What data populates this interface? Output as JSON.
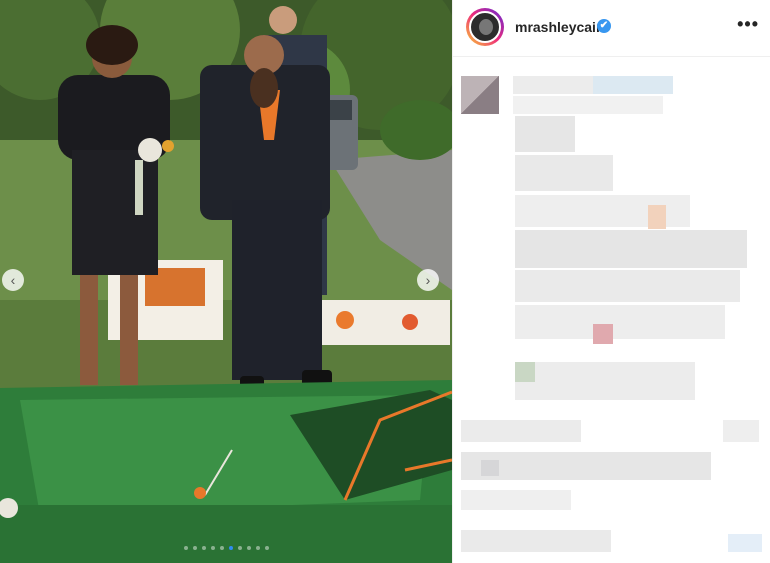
{
  "post": {
    "username": "mrashleycain",
    "verified_icon": "✔",
    "more_icon": "•••",
    "nav_prev_icon": "‹",
    "nav_next_icon": "›",
    "carousel": {
      "total_slides": 10,
      "active_index": 5
    }
  },
  "colors": {
    "accent": "#3897f0",
    "turf_green": "#2e7d3a",
    "orange_trim": "#e8782a"
  }
}
